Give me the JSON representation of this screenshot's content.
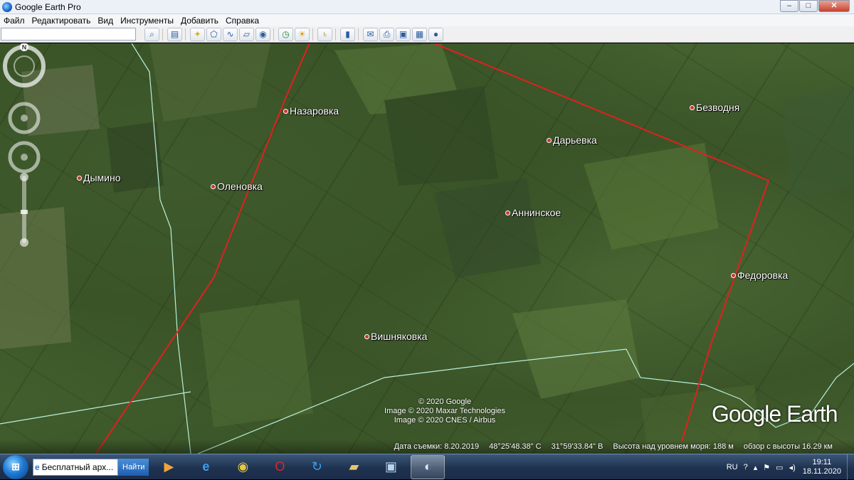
{
  "window": {
    "title": "Google Earth Pro",
    "minimize": "–",
    "maximize": "□",
    "close": "✕"
  },
  "menu": [
    "Файл",
    "Редактировать",
    "Вид",
    "Инструменты",
    "Добавить",
    "Справка"
  ],
  "toolbar": {
    "search_value": "",
    "search_icon": "search-icon"
  },
  "places": {
    "p0": "Назаровка",
    "p1": "Дымино",
    "p2": "Оленовка",
    "p3": "Дарьевка",
    "p4": "Безводня",
    "p5": "Аннинское",
    "p6": "Федоровка",
    "p7": "Вишняковка"
  },
  "attribution": {
    "line1": "© 2020 Google",
    "line2": "Image © 2020 Maxar Technologies",
    "line3": "Image © 2020 CNES / Airbus"
  },
  "logo": "Google Earth",
  "nav": {
    "north": "N"
  },
  "status": {
    "imagery_date": "Дата съемки: 8.20.2019",
    "lat": "48°25'48.38\" С",
    "lon": "31°59'33.84\" В",
    "elevation": "Высота над уровнем моря:  188 м",
    "eye_alt": "обзор с высоты  16.29 км"
  },
  "taskbar": {
    "search_text": "Бесплатный арх...",
    "search_button": "Найти",
    "lang": "RU",
    "time": "19:11",
    "date": "18.11.2020"
  }
}
